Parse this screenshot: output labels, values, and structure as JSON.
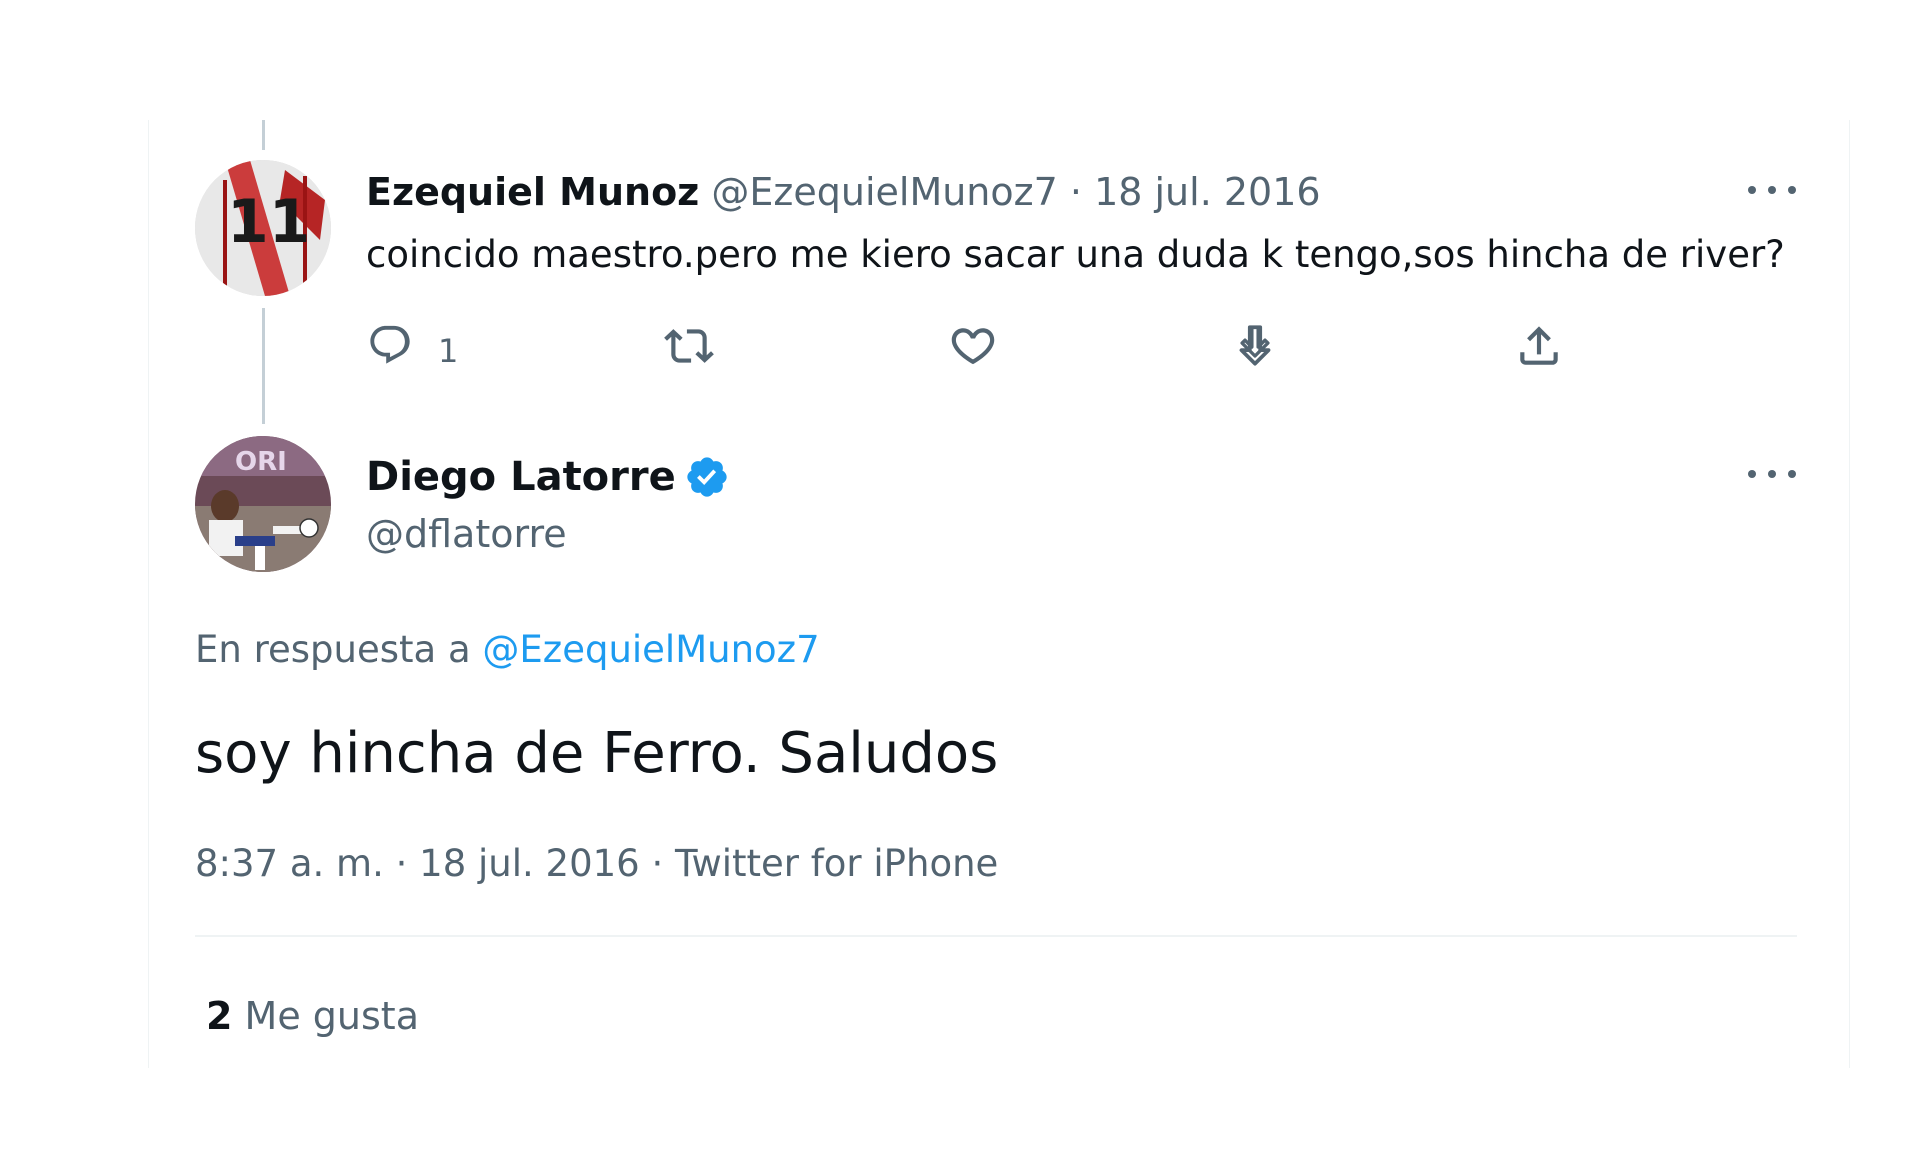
{
  "colors": {
    "text_primary": "#0f1419",
    "text_secondary": "#536471",
    "link": "#1d9bf0",
    "verified": "#1d9bf0",
    "thread_line": "#c4cfd6"
  },
  "reply_tweet": {
    "author_name": "Ezequiel Munoz",
    "handle": "@EzequielMunoz7",
    "separator": "·",
    "date": "18 jul. 2016",
    "text": "coincido maestro.pero me kiero sacar una duda k tengo,sos hincha de river?",
    "reply_count": "1",
    "avatar_icon": "jersey-number-11-avatar",
    "actions": [
      "reply-icon",
      "retweet-icon",
      "like-icon",
      "download-icon",
      "share-icon"
    ]
  },
  "main_tweet": {
    "author_name": "Diego Latorre",
    "handle": "@dflatorre",
    "verified": true,
    "avatar_icon": "soccer-player-avatar",
    "reply_prefix": "En respuesta a",
    "reply_handle": "@EzequielMunoz7",
    "text": "soy hincha de Ferro. Saludos",
    "time": "8:37 a. m.",
    "separator": "·",
    "date": "18 jul. 2016",
    "source": "Twitter for iPhone",
    "likes_count": "2",
    "likes_label": "Me gusta"
  }
}
